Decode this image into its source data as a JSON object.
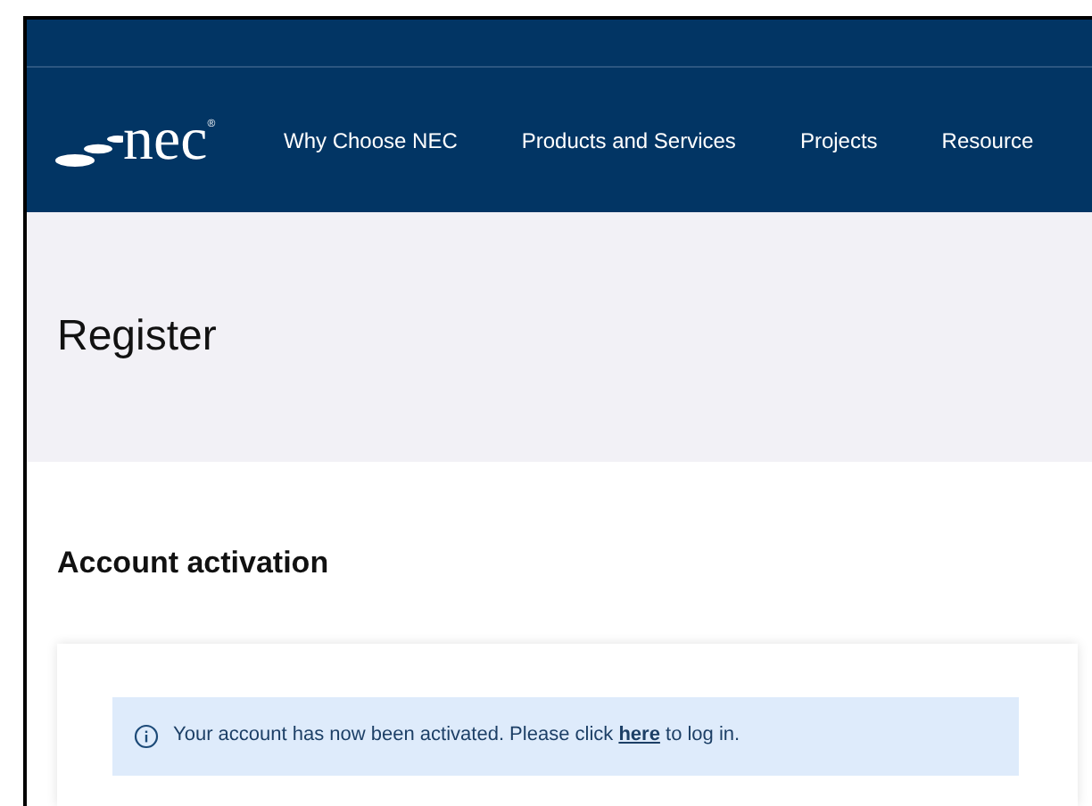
{
  "header": {
    "logo_text": "nec",
    "logo_mark": "®",
    "nav": [
      "Why Choose NEC",
      "Products and Services",
      "Projects",
      "Resource"
    ]
  },
  "page_title": "Register",
  "section_title": "Account activation",
  "alert": {
    "before": "Your account has now been activated. Please click ",
    "link": "here",
    "after": " to log in."
  }
}
